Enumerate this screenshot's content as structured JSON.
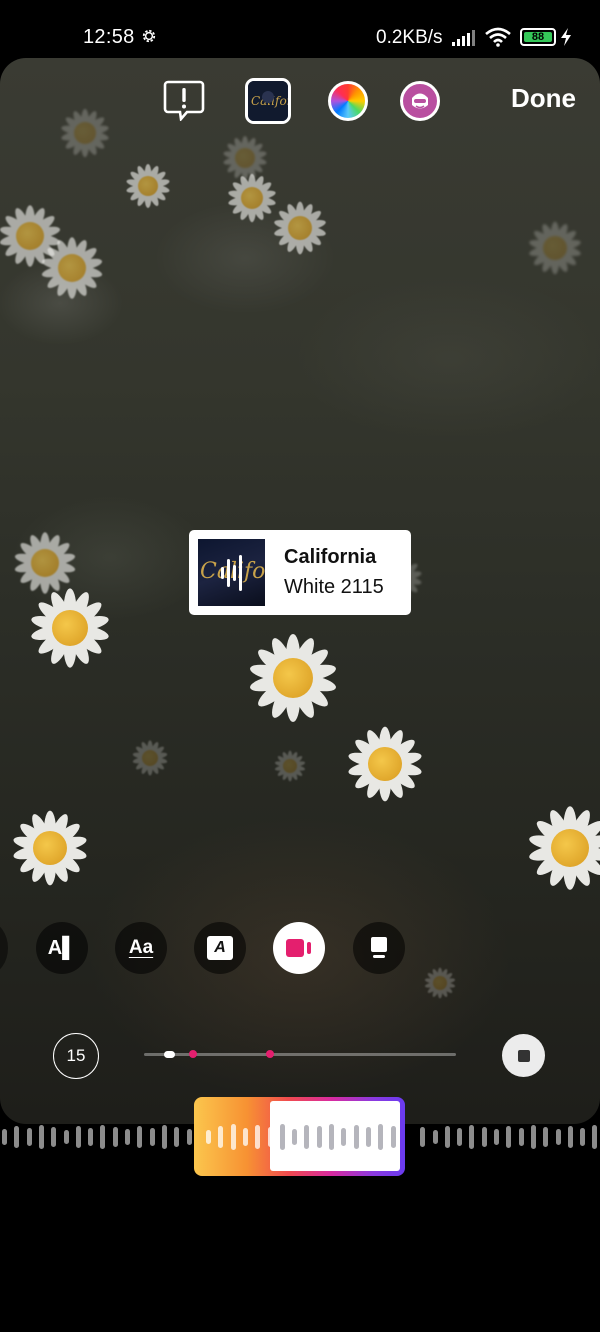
{
  "status": {
    "time": "12:58",
    "speed": "0.2KB/s",
    "battery": "88",
    "battery_color": "#35c759"
  },
  "toolbar": {
    "done_label": "Done",
    "icons": [
      "alert-icon",
      "album-art-thumbnail",
      "color-wheel-icon",
      "face-icon"
    ]
  },
  "sticker": {
    "title": "California",
    "artist": "White 2115",
    "art_text": "California"
  },
  "styles": {
    "items": [
      "text-left-style",
      "text-aa-style",
      "text-italic-box-style",
      "album-video-style",
      "album-card-style"
    ],
    "selected_index": 3,
    "accent": "#e41f6e"
  },
  "playback": {
    "duration": "15"
  },
  "scrubber": {
    "gradient": [
      "#fbc64d",
      "#f79233",
      "#f04a4f",
      "#d92ba0",
      "#8b3ae0",
      "#6a3bf0"
    ]
  }
}
